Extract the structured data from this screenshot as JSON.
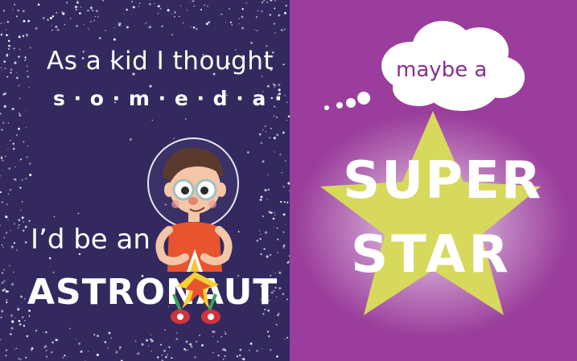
{
  "left_panel": {
    "line1": "As a kid I thought",
    "line2": "s · o · m · e · d · a · y",
    "line3": "I’d be an",
    "line4": "ASTRONAUT",
    "background": "#34295f"
  },
  "right_panel": {
    "bubble_text": "maybe a",
    "line1": "SUPER",
    "line2": "STAR",
    "background": "#9b3d9c",
    "star_color": "#d6d95b"
  }
}
